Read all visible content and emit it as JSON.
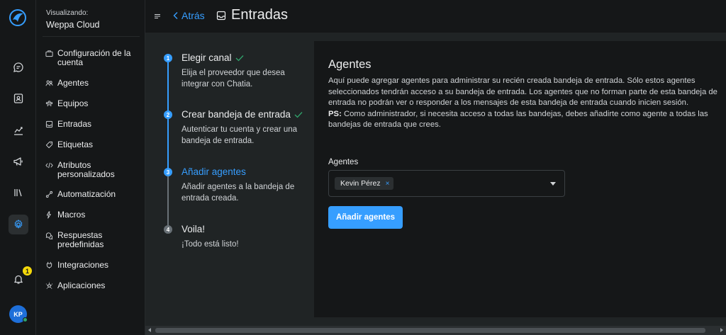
{
  "account": {
    "label": "Visualizando:",
    "name": "Weppa Cloud"
  },
  "rail": {
    "notification_count": "1",
    "avatar_initials": "KP"
  },
  "nav": [
    {
      "label": "Configuración de la cuenta",
      "icon": "briefcase-icon"
    },
    {
      "label": "Agentes",
      "icon": "people-icon"
    },
    {
      "label": "Equipos",
      "icon": "people-team-icon"
    },
    {
      "label": "Entradas",
      "icon": "mail-inbox-icon"
    },
    {
      "label": "Etiquetas",
      "icon": "tag-icon"
    },
    {
      "label": "Atributos personalizados",
      "icon": "code-icon"
    },
    {
      "label": "Automatización",
      "icon": "automation-icon"
    },
    {
      "label": "Macros",
      "icon": "flash-settings-icon"
    },
    {
      "label": "Respuestas predefinidas",
      "icon": "chat-multiple-icon"
    },
    {
      "label": "Integraciones",
      "icon": "plug-icon"
    },
    {
      "label": "Aplicaciones",
      "icon": "star-emphasis-icon"
    }
  ],
  "header": {
    "back_label": "Atrás",
    "title": "Entradas"
  },
  "steps": [
    {
      "number": "1",
      "title": "Elegir canal",
      "description": "Elija el proveedor que desea integrar con Chatia.",
      "done": true
    },
    {
      "number": "2",
      "title": "Crear bandeja de entrada",
      "description": "Autenticar tu cuenta y crear una bandeja de entrada.",
      "done": true
    },
    {
      "number": "3",
      "title": "Añadir agentes",
      "description": "Añadir agentes a la bandeja de entrada creada.",
      "active": true
    },
    {
      "number": "4",
      "title": "Voila!",
      "description": "¡Todo está listo!"
    }
  ],
  "panel": {
    "title": "Agentes",
    "description": "Aquí puede agregar agentes para administrar su recién creada bandeja de entrada. Sólo estos agentes seleccionados tendrán acceso a su bandeja de entrada. Los agentes que no forman parte de esta bandeja de entrada no podrán ver o responder a los mensajes de esta bandeja de entrada cuando inicien sesión.",
    "ps_label": "PS:",
    "ps_text": " Como administrador, si necesita acceso a todas las bandejas, debes añadirte como agente a todas las bandejas de entrada que crees.",
    "field_label": "Agentes",
    "selected_agents": [
      "Kevin Pérez"
    ],
    "remove_symbol": "×",
    "submit_label": "Añadir agentes"
  },
  "colors": {
    "accent": "#369eff",
    "badge": "#f5d90a",
    "online": "#30a46c"
  }
}
